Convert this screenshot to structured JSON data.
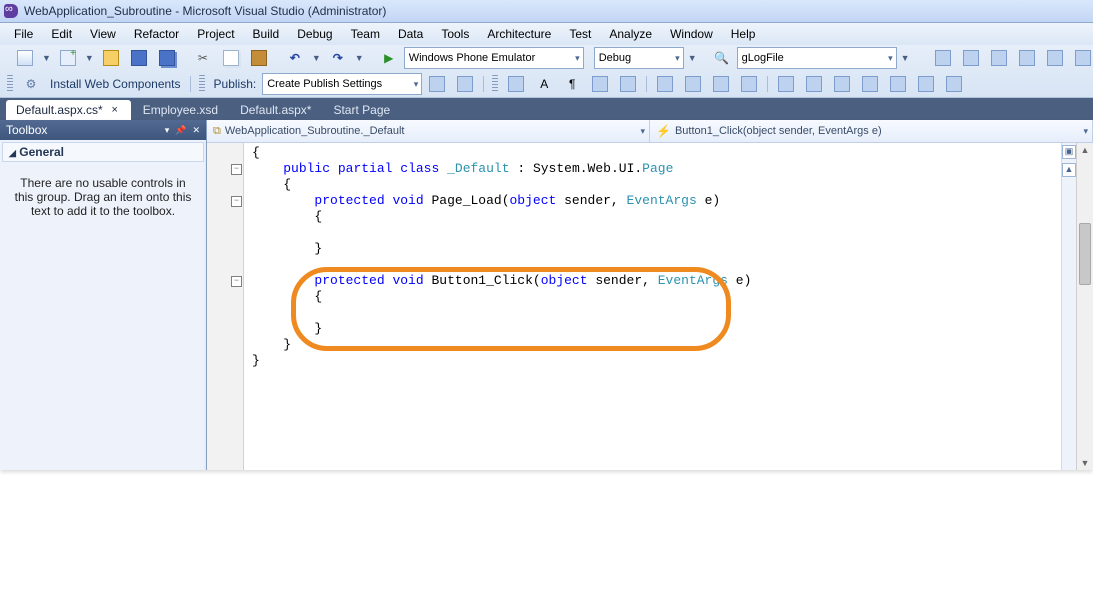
{
  "window": {
    "title": "WebApplication_Subroutine - Microsoft Visual Studio (Administrator)"
  },
  "menu": [
    "File",
    "Edit",
    "View",
    "Refactor",
    "Project",
    "Build",
    "Debug",
    "Team",
    "Data",
    "Tools",
    "Architecture",
    "Test",
    "Analyze",
    "Window",
    "Help"
  ],
  "toolbars": {
    "row1": {
      "target_combo": "Windows Phone Emulator",
      "config_combo": "Debug",
      "search_combo": "gLogFile"
    },
    "row2": {
      "install_label": "Install Web Components",
      "publish_label": "Publish:",
      "publish_combo": "Create Publish Settings"
    }
  },
  "doc_tabs": [
    {
      "label": "Default.aspx.cs*",
      "active": true,
      "closeable": true
    },
    {
      "label": "Employee.xsd",
      "active": false,
      "closeable": false
    },
    {
      "label": "Default.aspx*",
      "active": false,
      "closeable": false
    },
    {
      "label": "Start Page",
      "active": false,
      "closeable": false
    }
  ],
  "toolbox": {
    "title": "Toolbox",
    "section": "General",
    "message": "There are no usable controls in this group. Drag an item onto this text to add it to the toolbox."
  },
  "editor_nav": {
    "left": "WebApplication_Subroutine._Default",
    "right": "Button1_Click(object sender, EventArgs e)"
  },
  "code": {
    "type": "csharp",
    "lines": [
      {
        "text": "{",
        "indent": 0,
        "fold": null
      },
      {
        "indent": 1,
        "fold": "minus",
        "tokens": [
          [
            "kw",
            "public"
          ],
          [
            "sp",
            " "
          ],
          [
            "kw",
            "partial"
          ],
          [
            "sp",
            " "
          ],
          [
            "kw",
            "class"
          ],
          [
            "sp",
            " "
          ],
          [
            "tp",
            "_Default"
          ],
          [
            "sp",
            " "
          ],
          [
            "txt",
            ":"
          ],
          [
            "sp",
            " "
          ],
          [
            "txt",
            "System.Web.UI."
          ],
          [
            "tp",
            "Page"
          ]
        ]
      },
      {
        "text": "{",
        "indent": 1,
        "fold": null
      },
      {
        "indent": 2,
        "fold": "minus",
        "tokens": [
          [
            "kw",
            "protected"
          ],
          [
            "sp",
            " "
          ],
          [
            "kw",
            "void"
          ],
          [
            "sp",
            " "
          ],
          [
            "txt",
            "Page_Load("
          ],
          [
            "kw",
            "object"
          ],
          [
            "sp",
            " "
          ],
          [
            "txt",
            "sender, "
          ],
          [
            "tp",
            "EventArgs"
          ],
          [
            "sp",
            " "
          ],
          [
            "txt",
            "e)"
          ]
        ]
      },
      {
        "text": "{",
        "indent": 2,
        "fold": null
      },
      {
        "text": "",
        "indent": 2,
        "fold": null
      },
      {
        "text": "}",
        "indent": 2,
        "fold": null
      },
      {
        "text": "",
        "indent": 2,
        "fold": null
      },
      {
        "indent": 2,
        "fold": "minus",
        "tokens": [
          [
            "kw",
            "protected"
          ],
          [
            "sp",
            " "
          ],
          [
            "kw",
            "void"
          ],
          [
            "sp",
            " "
          ],
          [
            "txt",
            "Button1_Click("
          ],
          [
            "kw",
            "object"
          ],
          [
            "sp",
            " "
          ],
          [
            "txt",
            "sender, "
          ],
          [
            "tp",
            "EventArgs"
          ],
          [
            "sp",
            " "
          ],
          [
            "txt",
            "e)"
          ]
        ]
      },
      {
        "text": "{",
        "indent": 2,
        "fold": null
      },
      {
        "text": "",
        "indent": 2,
        "fold": null
      },
      {
        "text": "}",
        "indent": 2,
        "fold": null
      },
      {
        "text": "}",
        "indent": 1,
        "fold": null
      },
      {
        "text": "}",
        "indent": 0,
        "fold": null
      }
    ]
  },
  "annotation": {
    "target_method": "Button1_Click",
    "color": "#ee8a1f"
  }
}
